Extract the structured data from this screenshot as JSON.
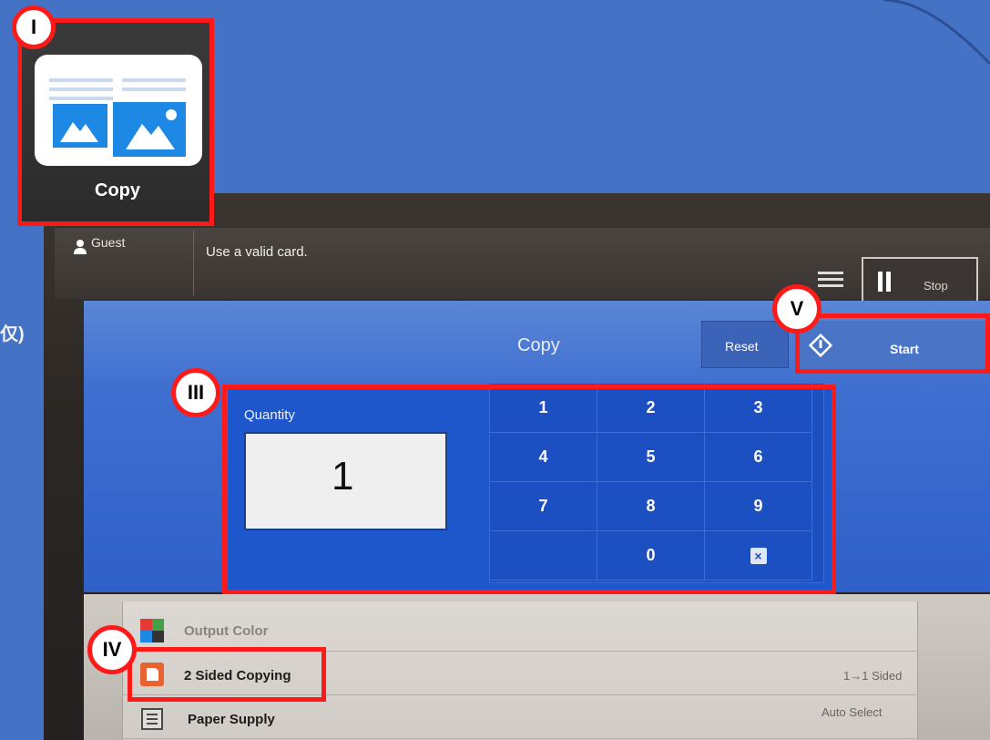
{
  "app_tile": {
    "label": "Copy"
  },
  "topbar": {
    "user_label": "Guest",
    "message": "Use a valid card.",
    "stop_label": "Stop"
  },
  "header": {
    "title": "Copy",
    "reset_label": "Reset",
    "start_label": "Start"
  },
  "quantity": {
    "label": "Quantity",
    "value": "1"
  },
  "keypad": {
    "keys": [
      "1",
      "2",
      "3",
      "4",
      "5",
      "6",
      "7",
      "8",
      "9",
      "",
      "0",
      "×"
    ]
  },
  "settings_list": [
    {
      "label": "Output Color",
      "value": "",
      "icon": "color-palette-icon"
    },
    {
      "label": "2 Sided Copying",
      "value": "1→1 Sided",
      "icon": "duplex-icon"
    },
    {
      "label": "Paper Supply",
      "value": "Auto Select",
      "icon": "paper-tray-icon"
    }
  ],
  "annotations": [
    "I",
    "III",
    "IV",
    "V"
  ],
  "side_fragment": "仅)",
  "colors": {
    "annotation_red": "#ff1a1a",
    "slide_blue": "#4472c4",
    "panel_blue": "#1e56cc"
  }
}
